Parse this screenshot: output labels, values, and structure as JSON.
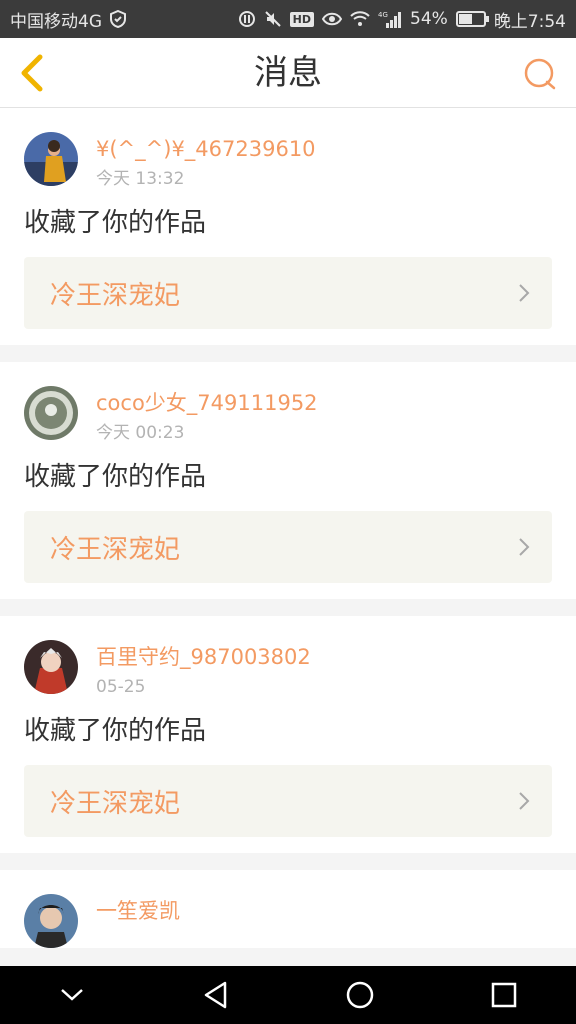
{
  "status_bar": {
    "carrier": "中国移动4G",
    "network_label": "4G",
    "battery": "54%",
    "battery_level": 0.54,
    "time": "晚上7:54"
  },
  "header": {
    "title": "消息",
    "back_icon": "back-arrow-icon",
    "right_icon": "chat-bubble-icon"
  },
  "colors": {
    "accent": "#f39a62",
    "chevron": "#f0b400",
    "card_bg": "#f5f5ef"
  },
  "messages": [
    {
      "username": "¥(^_^)¥_467239610",
      "time": "今天 13:32",
      "action": "收藏了你的作品",
      "work_title": "冷王深宠妃"
    },
    {
      "username": "coco少女_749111952",
      "time": "今天 00:23",
      "action": "收藏了你的作品",
      "work_title": "冷王深宠妃"
    },
    {
      "username": "百里守约_987003802",
      "time": "05-25",
      "action": "收藏了你的作品",
      "work_title": "冷王深宠妃"
    },
    {
      "username": "一笙爱凯",
      "time": "",
      "action": "",
      "work_title": ""
    }
  ],
  "nav": {
    "back": "nav-back-icon",
    "home": "nav-home-icon",
    "recents": "nav-recents-icon",
    "hide": "nav-hide-icon"
  }
}
